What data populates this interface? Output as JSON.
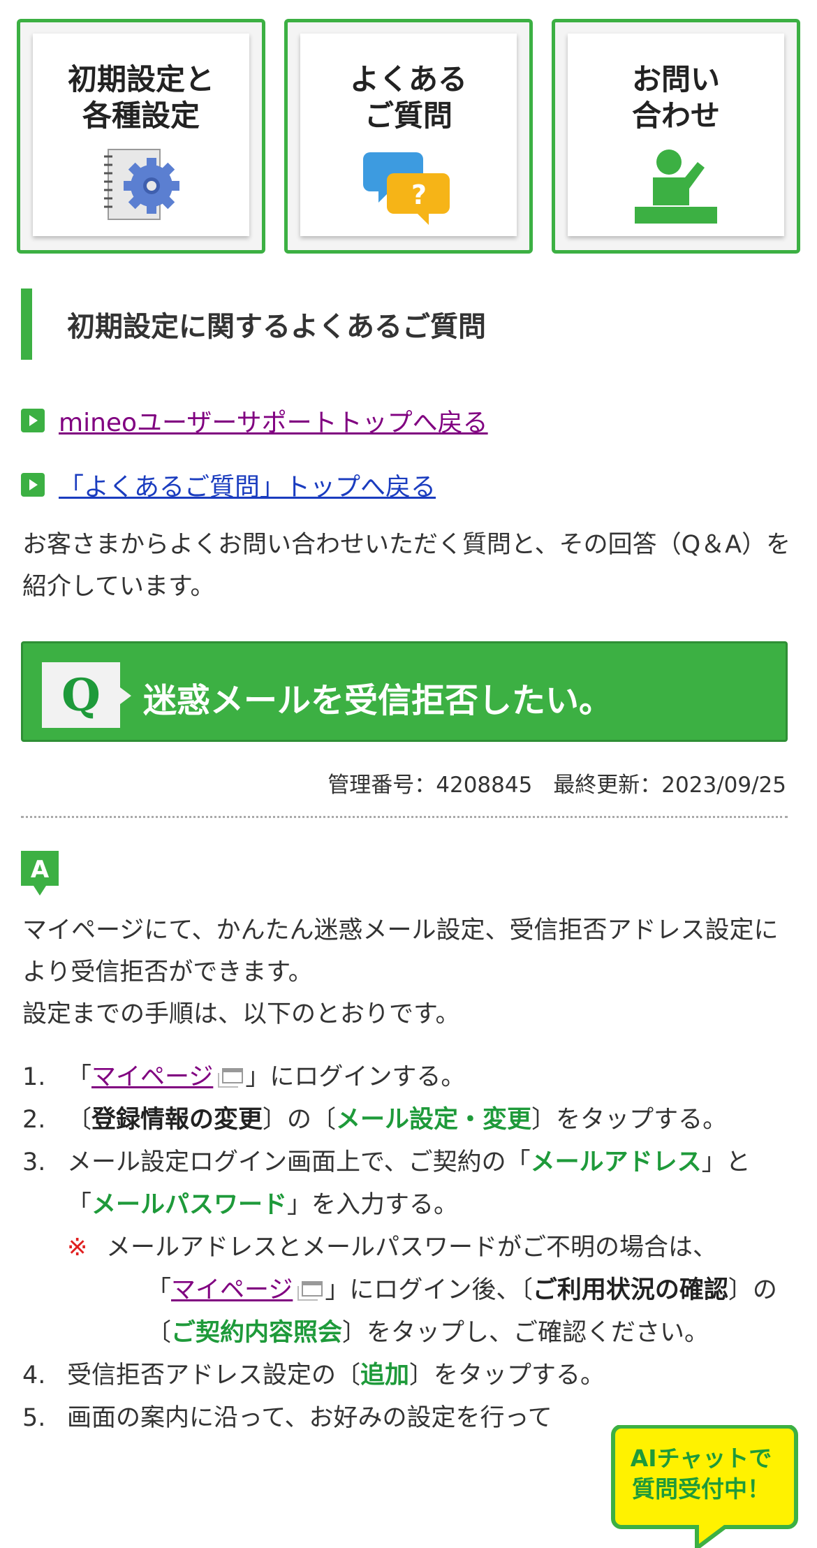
{
  "tiles": [
    {
      "label": "初期設定と\n各種設定",
      "icon": "notebook-gear-icon"
    },
    {
      "label": "よくある\nご質問",
      "icon": "speech-bubbles-question-icon"
    },
    {
      "label": "お問い\n合わせ",
      "icon": "person-at-desk-icon"
    }
  ],
  "section": {
    "title": "初期設定に関するよくあるご質問"
  },
  "links": {
    "support_top": "mineoユーザーサポートトップへ戻る",
    "faq_top": "「よくあるご質問」トップへ戻る"
  },
  "intro": "お客さまからよくお問い合わせいただく質問と、その回答（Q＆A）を紹介しています。",
  "question": {
    "badge": "Q",
    "text": "迷惑メールを受信拒否したい。"
  },
  "meta": {
    "id": "管理番号：4208845",
    "updated": "最終更新：2023/09/25"
  },
  "answer": {
    "badge": "A",
    "line1": "マイページにて、かんたん迷惑メール設定、受信拒否アドレス設定により受信拒否ができます。",
    "line2": "設定までの手順は、以下のとおりです。"
  },
  "steps": {
    "s1": {
      "num": "1.",
      "pre": "「",
      "link": "マイページ",
      "post": "」にログインする。"
    },
    "s2": {
      "num": "2.",
      "a": "〔",
      "b": "登録情報の変更",
      "c": "〕の〔",
      "d": "メール設定・変更",
      "e": "〕をタップする。"
    },
    "s3": {
      "num": "3.",
      "a": "メール設定ログイン画面上で、ご契約の「",
      "b": "メールアドレス",
      "c": "」と「",
      "d": "メールパスワード",
      "e": "」を入力する。"
    },
    "note": {
      "mark": "※",
      "a": "メールアドレスとメールパスワードがご不明の場合は、",
      "b": "「",
      "link": "マイページ",
      "c": "」にログイン後、〔",
      "d": "ご利用状況の確認",
      "e": "〕の〔",
      "f": "ご契約内容照会",
      "g": "〕をタップし、ご確認ください。"
    },
    "s4": {
      "num": "4.",
      "a": "受信拒否アドレス設定の〔",
      "b": "追加",
      "c": "〕をタップする。"
    },
    "s5": {
      "num": "5.",
      "a": "画面の案内に沿って、お好みの設定を行って"
    }
  },
  "ai_chat": {
    "text": "AIチャットで\n質問受付中！"
  },
  "colors": {
    "accent": "#3cb043",
    "dark_green": "#1e9a3a",
    "visited_link": "#800080",
    "link": "#1a3cbf",
    "note_red": "#e02020",
    "ai_yellow": "#fff200"
  }
}
